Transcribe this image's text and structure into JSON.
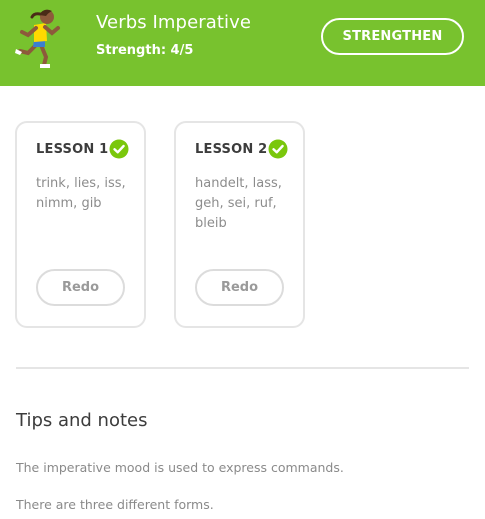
{
  "header": {
    "title": "Verbs Imperative",
    "strength": "Strength: 4/5",
    "strengthen_label": "STRENGTHEN",
    "icon": "runner-icon",
    "background": "#78c22e"
  },
  "lessons": [
    {
      "title": "LESSON 1",
      "words": "trink, lies, iss, nimm, gib",
      "button_label": "Redo",
      "completed": true
    },
    {
      "title": "LESSON 2",
      "words": "handelt, lass, geh, sei, ruf, bleib",
      "button_label": "Redo",
      "completed": true
    }
  ],
  "tips": {
    "title": "Tips and notes",
    "paragraphs": [
      "The imperative mood is used to express commands.",
      "There are three different forms."
    ]
  },
  "colors": {
    "accent_green": "#78c22e",
    "check_green": "#7ac70c",
    "card_border": "#e5e5e5"
  }
}
